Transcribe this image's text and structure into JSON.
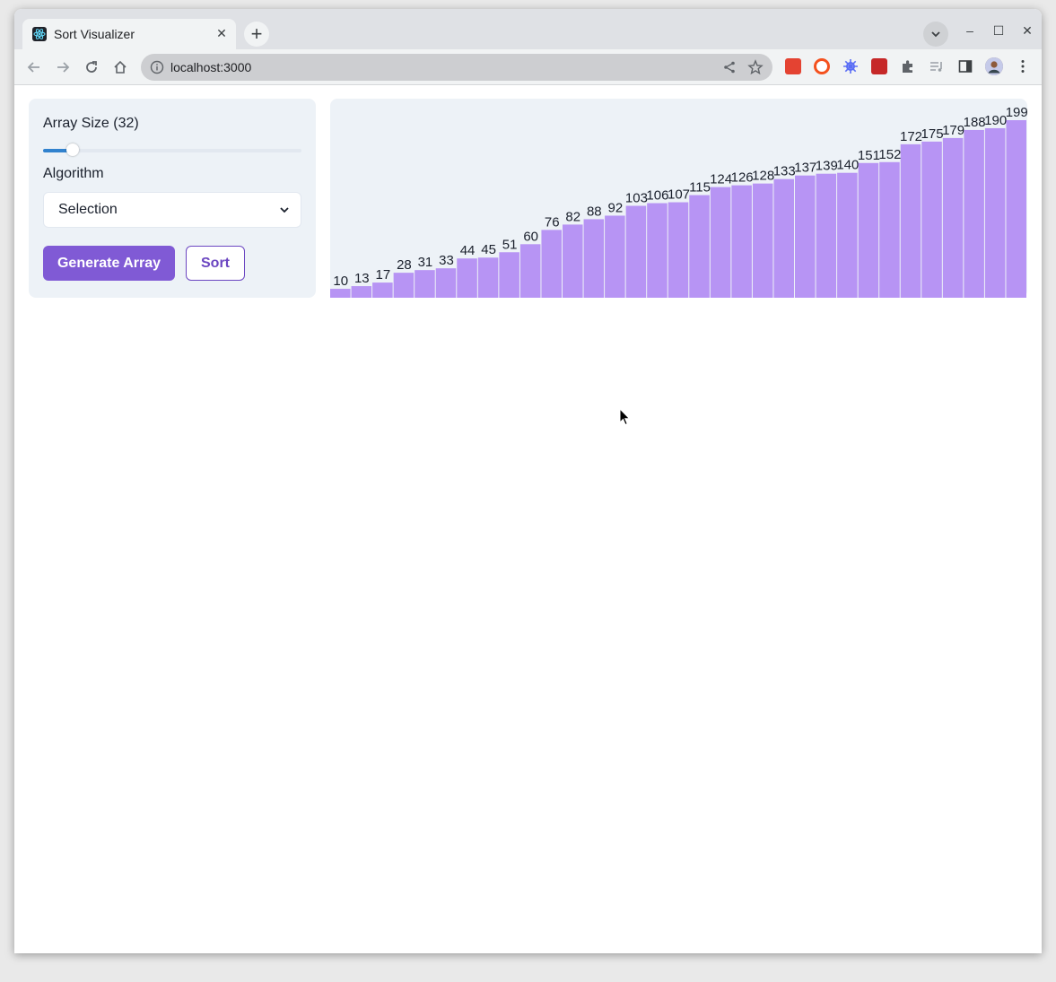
{
  "browser": {
    "tab_title": "Sort Visualizer",
    "tab_close": "✕",
    "new_tab": "+",
    "url": "localhost:3000",
    "window_controls": {
      "minimize": "–",
      "maximize": "☐",
      "close": "✕"
    },
    "extensions": [
      {
        "name": "todoist-extension",
        "color": "#e44332"
      },
      {
        "name": "ext-orange-circle",
        "color": "#f4511e"
      },
      {
        "name": "ext-blue-flower",
        "color": "#5b6ef5"
      },
      {
        "name": "ext-red-square",
        "color": "#c62828"
      },
      {
        "name": "extensions-puzzle-icon",
        "color": "#5f6368"
      }
    ]
  },
  "controls": {
    "array_size_label": "Array Size (32)",
    "array_size_value": 32,
    "slider_fraction": 0.115,
    "algorithm_label": "Algorithm",
    "algorithm_selected": "Selection",
    "generate_label": "Generate Array",
    "sort_label": "Sort"
  },
  "colors": {
    "bar": "#b794f4",
    "accent": "#805ad5",
    "slider": "#3182ce",
    "panel_bg": "#edf2f7"
  },
  "chart_data": {
    "type": "bar",
    "title": "",
    "xlabel": "",
    "ylabel": "",
    "values": [
      10,
      13,
      17,
      28,
      31,
      33,
      44,
      45,
      51,
      60,
      76,
      82,
      88,
      92,
      103,
      106,
      107,
      115,
      124,
      126,
      128,
      133,
      137,
      139,
      140,
      151,
      152,
      172,
      175,
      179,
      188,
      190,
      199
    ],
    "data_labels": true
  }
}
